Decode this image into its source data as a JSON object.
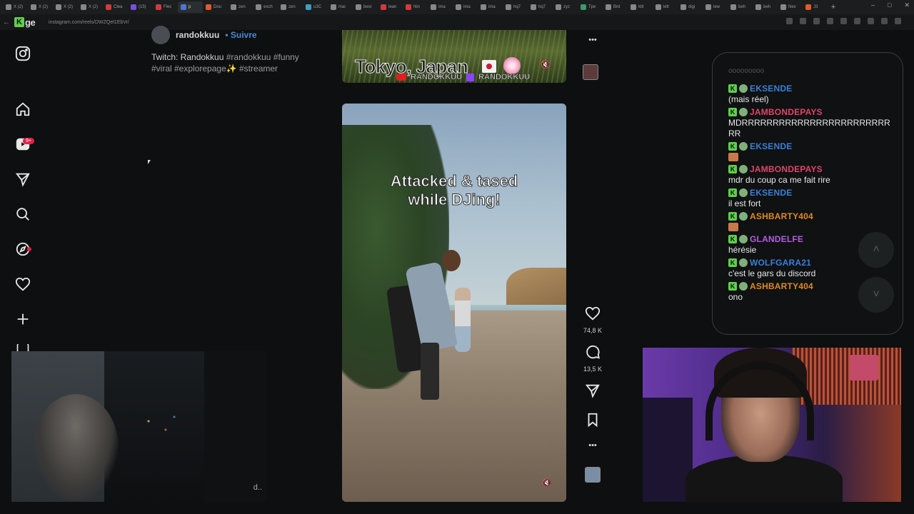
{
  "browser": {
    "tabs": [
      {
        "label": "X (2)",
        "color": "#888888"
      },
      {
        "label": "X (2)",
        "color": "#888888"
      },
      {
        "label": "X (2)",
        "color": "#888888"
      },
      {
        "label": "X (2)",
        "color": "#888888"
      },
      {
        "label": "Clea",
        "color": "#d33a3a"
      },
      {
        "label": "(15)",
        "color": "#7a4de0"
      },
      {
        "label": "Flec",
        "color": "#d33a3a"
      },
      {
        "label": "p",
        "color": "#4b77d1",
        "active": true
      },
      {
        "label": "Dou",
        "color": "#e05a2a"
      },
      {
        "label": "zen",
        "color": "#888888"
      },
      {
        "label": "exch",
        "color": "#888888"
      },
      {
        "label": "zen",
        "color": "#888888"
      },
      {
        "label": "u3C",
        "color": "#3aa0c0"
      },
      {
        "label": "mai",
        "color": "#888888"
      },
      {
        "label": "best",
        "color": "#888888"
      },
      {
        "label": "lean",
        "color": "#d33a3a"
      },
      {
        "label": "Nin",
        "color": "#d33a3a"
      },
      {
        "label": "ima",
        "color": "#888888"
      },
      {
        "label": "ima",
        "color": "#888888"
      },
      {
        "label": "ima",
        "color": "#888888"
      },
      {
        "label": "hq7",
        "color": "#888888"
      },
      {
        "label": "hq7",
        "color": "#888888"
      },
      {
        "label": "zyz",
        "color": "#888888"
      },
      {
        "label": "Tpe",
        "color": "#3a9a6a"
      },
      {
        "label": "Brd",
        "color": "#888888"
      },
      {
        "label": "kitt",
        "color": "#888888"
      },
      {
        "label": "kitt",
        "color": "#888888"
      },
      {
        "label": "digi",
        "color": "#888888"
      },
      {
        "label": "lew",
        "color": "#888888"
      },
      {
        "label": "beh",
        "color": "#888888"
      },
      {
        "label": "beh",
        "color": "#888888"
      },
      {
        "label": "Nex",
        "color": "#888888"
      },
      {
        "label": "J3",
        "color": "#e05a2a"
      }
    ],
    "new_tab": "+",
    "url": "instagram.com/reels/DWZQel1EbVr/",
    "window_controls": [
      "–",
      "□",
      "✕"
    ]
  },
  "logo": {
    "k": "K",
    "rest": "ge"
  },
  "sidebar": {
    "badge": "9+"
  },
  "post": {
    "username": "randokkuu",
    "follow": "• Suivre",
    "caption_text": "Twitch: Randokkuu",
    "caption_tags": "#randokkuu #funny #viral #explorepage✨ #streamer"
  },
  "reel_top": {
    "location": "Tokyo, Japan",
    "credit_yt": "RANDOKKUU",
    "credit_tw": "RANDOKKUU",
    "mute_icon": "🔇"
  },
  "reel": {
    "title_line1": "Attacked & tased",
    "title_line2": "while DJing!",
    "mute_icon": "🔇"
  },
  "actions": {
    "likes": "74,8 K",
    "comments": "13,5 K",
    "more": "•••"
  },
  "chat": {
    "faded": "ooooooooo",
    "messages": [
      {
        "user": "EKSENDE",
        "color": "#3b7fd9",
        "text": "(mais réel)",
        "emote": false
      },
      {
        "user": "JAMBONDEPAYS",
        "color": "#e0456a",
        "text": "MDRRRRRRRRRRRRRRRRRRRRRRRRRR",
        "emote": false
      },
      {
        "user": "EKSENDE",
        "color": "#3b7fd9",
        "text": "",
        "emote": true
      },
      {
        "user": "JAMBONDEPAYS",
        "color": "#e0456a",
        "text": "mdr du coup ca me fait rire",
        "emote": false
      },
      {
        "user": "EKSENDE",
        "color": "#3b7fd9",
        "text": "il est fort",
        "emote": false
      },
      {
        "user": "ASHBARTY404",
        "color": "#e08a1e",
        "text": "",
        "emote": true
      },
      {
        "user": "GLANDELFE",
        "color": "#b35ee0",
        "text": "hérésie",
        "emote": false
      },
      {
        "user": "WOLFGARA21",
        "color": "#3b7fd9",
        "text": "c'est le gars du discord",
        "emote": false
      },
      {
        "user": "ASHBARTY404",
        "color": "#e08a1e",
        "text": "ono",
        "emote": false
      }
    ],
    "scroll_up": "˄",
    "scroll_down": "˅"
  },
  "webcam_left": {
    "trailing_text": "d.."
  }
}
